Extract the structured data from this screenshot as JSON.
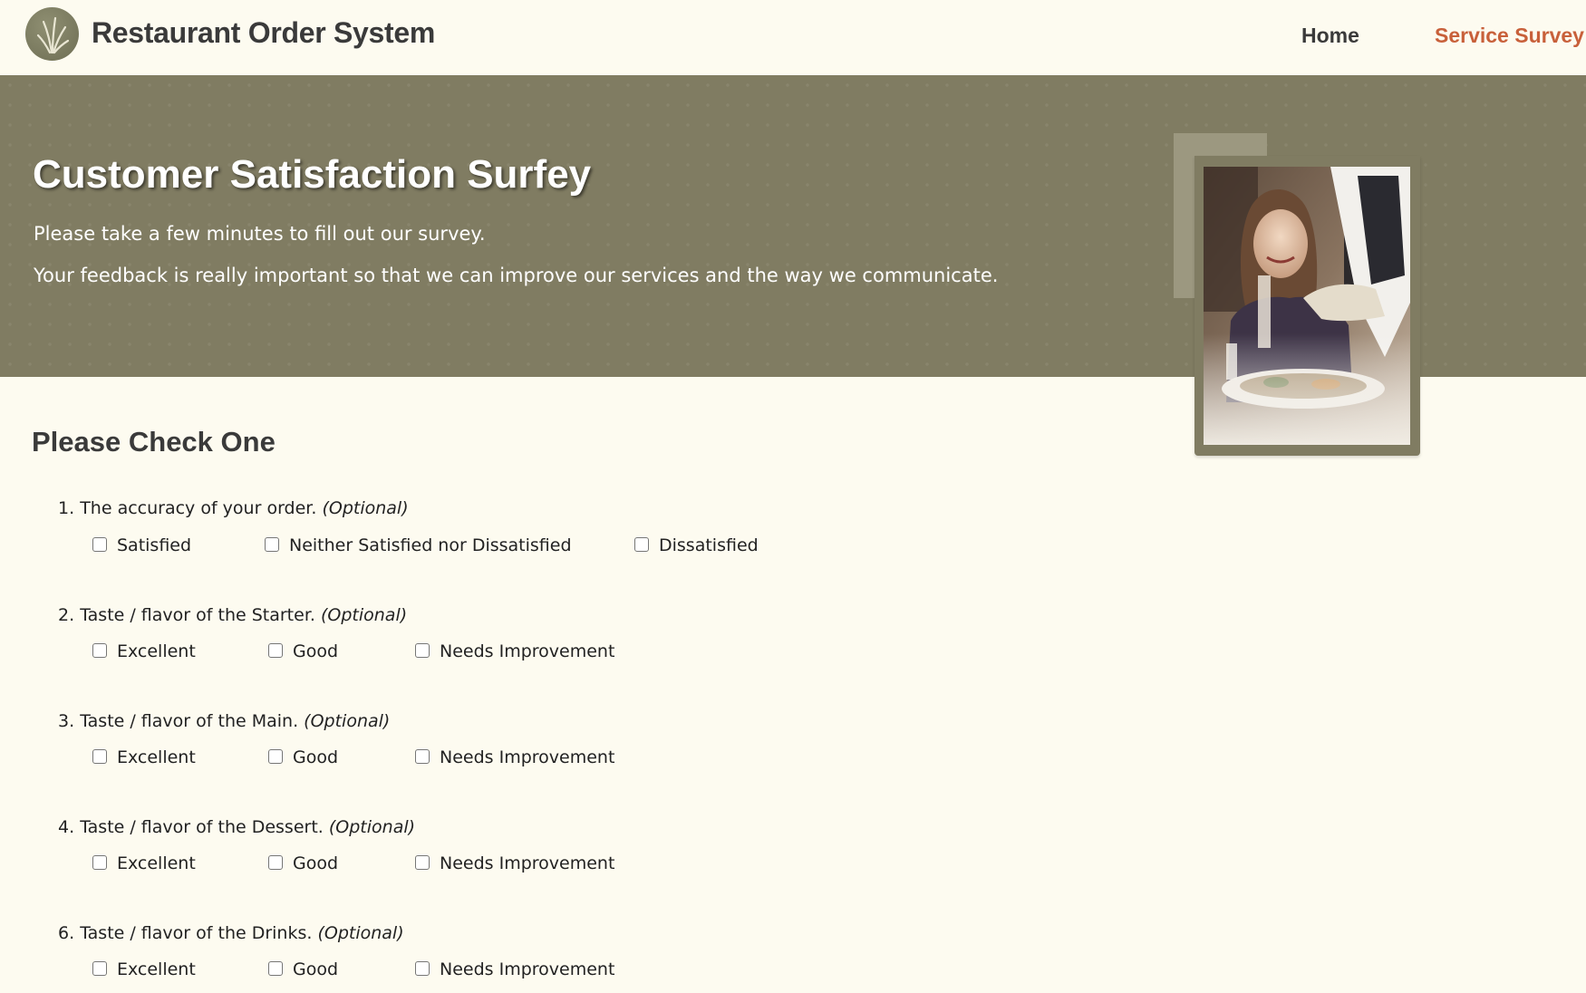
{
  "header": {
    "logo_icon": "wheat-grass-logo-icon",
    "title": "Restaurant Order System",
    "nav": [
      {
        "label": "Home",
        "active": false
      },
      {
        "label": "Service Survey",
        "active": true
      }
    ],
    "active_color": "#c8603a"
  },
  "hero": {
    "title": "Customer Satisfaction Surfey",
    "line1": "Please take a few minutes to fill out our survey.",
    "line2": "Your feedback is really important so that we can improve our services and the way we communicate.",
    "background_color": "#807c62"
  },
  "survey": {
    "section_title": "Please Check One",
    "optional_label": "(Optional)",
    "questions": [
      {
        "number": "1.",
        "text": "The accuracy of your order.",
        "choices": [
          "Satisfied",
          "Neither Satisfied nor Dissatisfied",
          "Dissatisfied"
        ]
      },
      {
        "number": "2.",
        "text": "Taste / flavor of the Starter.",
        "choices": [
          "Excellent",
          "Good",
          "Needs Improvement"
        ]
      },
      {
        "number": "3.",
        "text": "Taste / flavor of the Main.",
        "choices": [
          "Excellent",
          "Good",
          "Needs Improvement"
        ]
      },
      {
        "number": "4.",
        "text": "Taste / flavor of the Dessert.",
        "choices": [
          "Excellent",
          "Good",
          "Needs Improvement"
        ]
      },
      {
        "number": "6.",
        "text": "Taste / flavor of the Drinks.",
        "choices": [
          "Excellent",
          "Good",
          "Needs Improvement"
        ]
      }
    ]
  }
}
